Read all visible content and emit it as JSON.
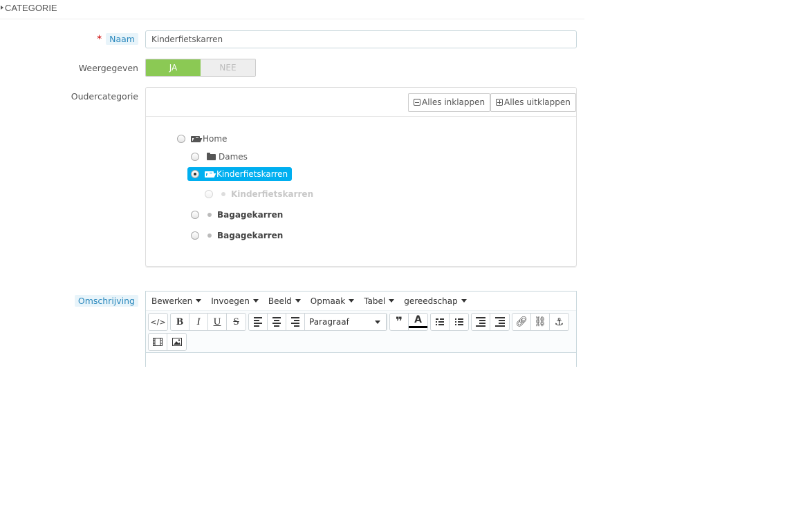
{
  "panel": {
    "title": "CATEGORIE"
  },
  "form": {
    "name_label": "Naam",
    "name_required": "*",
    "name_value": "Kinderfietskarren",
    "displayed_label": "Weergegeven",
    "displayed_yes": "JA",
    "displayed_no": "NEE",
    "parent_label": "Oudercategorie",
    "description_label": "Omschrijving"
  },
  "tree": {
    "collapse_label": "Alles inklappen",
    "expand_label": "Alles uitklappen",
    "nodes": [
      {
        "label": "Home",
        "icon": "folder-open-icon",
        "checked": false
      },
      {
        "label": "Dames",
        "icon": "folder-icon",
        "checked": false
      },
      {
        "label": "Kinderfietskarren",
        "icon": "folder-open-icon",
        "checked": true,
        "selected": true
      },
      {
        "label": "Kinderfietskarren",
        "icon": "bullet-icon",
        "checked": false,
        "disabled": true
      },
      {
        "label": "Bagagekarren",
        "icon": "bullet-icon",
        "checked": false
      },
      {
        "label": "Bagagekarren",
        "icon": "bullet-icon",
        "checked": false
      }
    ]
  },
  "editor": {
    "menus": [
      "Bewerken",
      "Invoegen",
      "Beeld",
      "Opmaak",
      "Tabel",
      "gereedschap"
    ],
    "format_select": "Paragraaf",
    "buttons": {
      "source": "</>",
      "bold": "B",
      "italic": "I",
      "underline": "U",
      "strike": "S",
      "blockquote": "❞",
      "text_color": "A"
    }
  },
  "colors": {
    "accent": "#00aff0",
    "toggle_on": "#8bc954",
    "label_bg": "#e8f4fa",
    "label_text": "#2a88bd"
  }
}
